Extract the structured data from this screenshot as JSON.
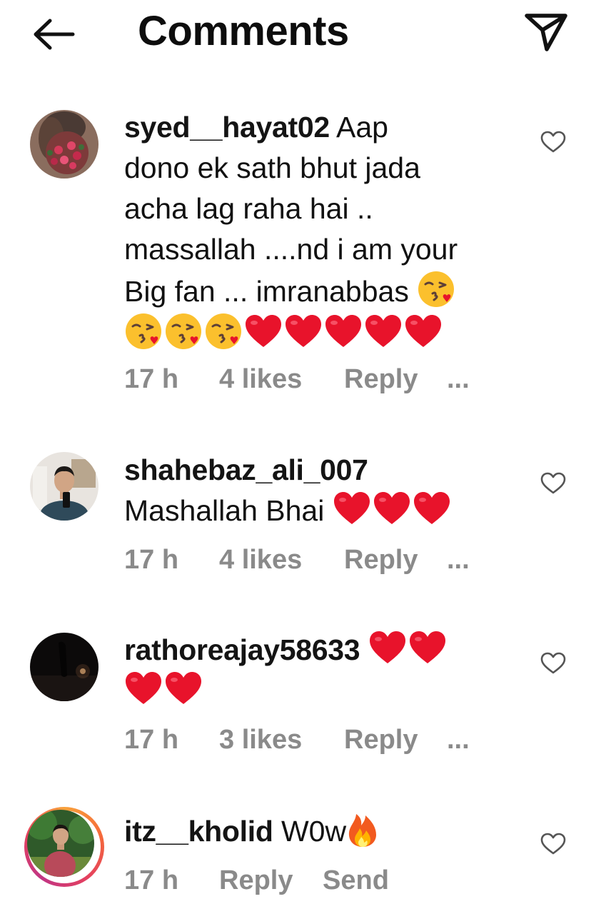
{
  "header": {
    "title": "Comments",
    "back_icon": "back-arrow-icon",
    "share_icon": "paper-plane-icon"
  },
  "comments": [
    {
      "username": "syed__hayat02",
      "text_lines": [
        "Aap",
        "dono ek sath bhut jada",
        "acha lag raha hai ..",
        "massallah ....nd i am your",
        "Big fan ... imranabbas"
      ],
      "emojis": [
        "kiss",
        "kiss",
        "kiss",
        "kiss",
        "heart",
        "heart",
        "heart",
        "heart",
        "heart"
      ],
      "time": "17 h",
      "likes": "4 likes",
      "reply": "Reply",
      "more": "..."
    },
    {
      "username": "shahebaz_ali_007",
      "text": "Mashallah Bhai",
      "emojis": [
        "heart",
        "heart",
        "heart"
      ],
      "time": "17 h",
      "likes": "4 likes",
      "reply": "Reply",
      "more": "..."
    },
    {
      "username": "rathoreajay58633",
      "emojis": [
        "heart",
        "heart",
        "heart",
        "heart"
      ],
      "time": "17 h",
      "likes": "3 likes",
      "reply": "Reply",
      "more": "..."
    },
    {
      "username": "itz__kholid",
      "text": "W0w",
      "emojis": [
        "fire"
      ],
      "time": "17 h",
      "reply": "Reply",
      "send": "Send",
      "has_story_ring": true
    }
  ],
  "colors": {
    "text": "#111111",
    "meta": "#8a8a8a",
    "heart": "#e8132b",
    "kiss_face": "#fbc02d",
    "story_ring": "#e4405f"
  }
}
